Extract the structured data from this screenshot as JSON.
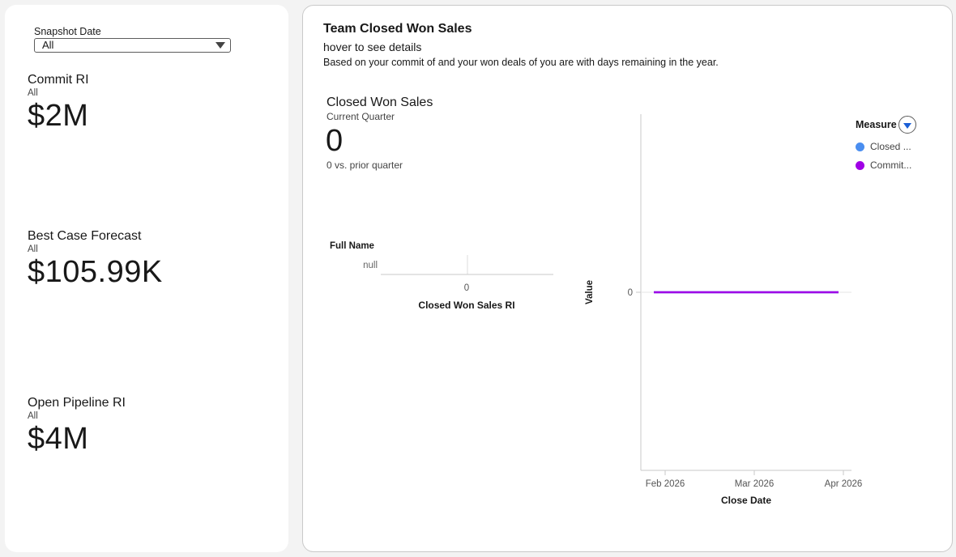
{
  "snapshot": {
    "label": "Snapshot Date",
    "selected": "All"
  },
  "metrics": [
    {
      "title": "Commit RI",
      "sub": "All",
      "value": "$2M"
    },
    {
      "title": "Best Case Forecast",
      "sub": "All",
      "value": "$105.99K"
    },
    {
      "title": "Open Pipeline RI",
      "sub": "All",
      "value": "$4M"
    }
  ],
  "team": {
    "title": "Team Closed Won Sales",
    "hover_text": "hover to see details",
    "based_text": "Based on your commit of  and your won deals of  you are with  days remaining in the year."
  },
  "closed_won": {
    "title": "Closed Won Sales",
    "sub": "Current Quarter",
    "value": "0",
    "vs_text": "0 vs. prior quarter"
  },
  "colors": {
    "closed_won": "#4a8ef0",
    "commit": "#a000e6",
    "accent": "#1b5fd6"
  },
  "chart_data": [
    {
      "type": "bar",
      "orientation": "horizontal",
      "y_header": "Full Name",
      "categories": [
        "null"
      ],
      "values": [
        0
      ],
      "x_ticks": [
        "0"
      ],
      "xlabel": "Closed Won Sales RI"
    },
    {
      "type": "line",
      "xlabel": "Close Date",
      "ylabel": "Value",
      "x_ticks": [
        "Feb 2026",
        "Mar 2026",
        "Apr 2026"
      ],
      "y_ticks": [
        "0"
      ],
      "legend_title": "Measure",
      "legend_position": "top-right",
      "series": [
        {
          "name": "Closed ...",
          "color": "#4a8ef0",
          "x": [
            "Feb 2026",
            "Apr 2026"
          ],
          "values": [
            0,
            0
          ]
        },
        {
          "name": "Commit...",
          "color": "#a000e6",
          "x": [
            "Feb 2026",
            "Apr 2026"
          ],
          "values": [
            0,
            0
          ]
        }
      ]
    }
  ]
}
